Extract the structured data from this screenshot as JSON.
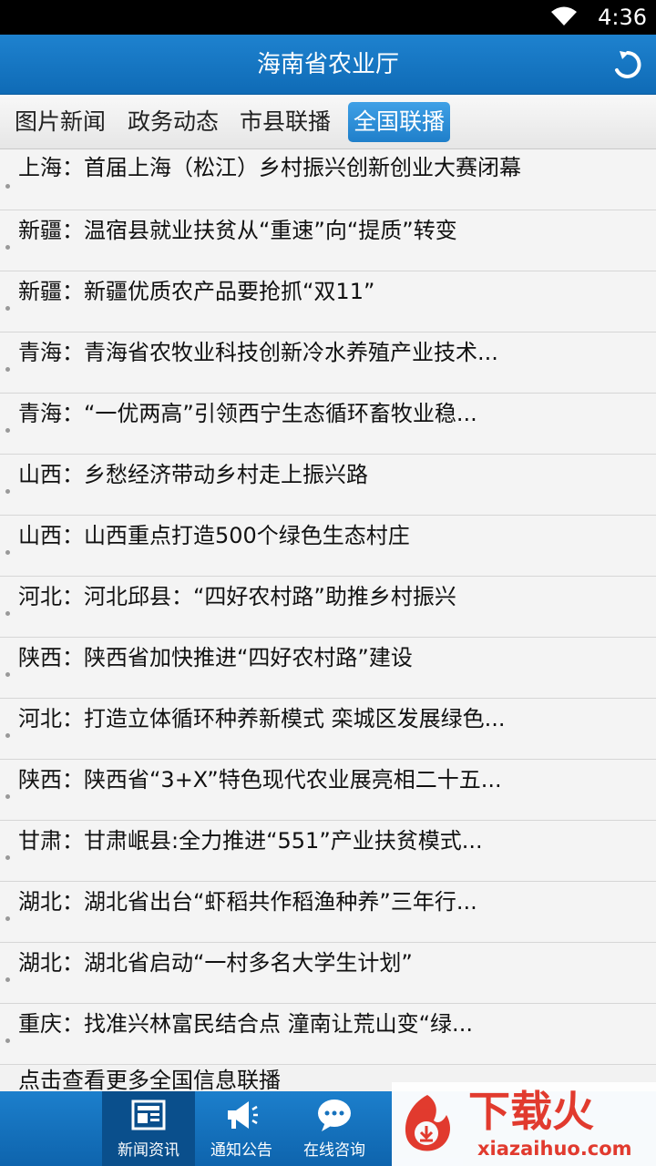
{
  "status_bar": {
    "time": "4:36",
    "wifi_icon": "wifi-icon"
  },
  "header": {
    "title": "海南省农业厅",
    "refresh_icon": "refresh-icon"
  },
  "tabs": [
    {
      "label": "图片新闻",
      "active": false
    },
    {
      "label": "政务动态",
      "active": false
    },
    {
      "label": "市县联播",
      "active": false
    },
    {
      "label": "全国联播",
      "active": true
    }
  ],
  "news": [
    "上海：首届上海（松江）乡村振兴创新创业大赛闭幕",
    "新疆：温宿县就业扶贫从“重速”向“提质”转变",
    "新疆：新疆优质农产品要抢抓“双11”",
    "青海：青海省农牧业科技创新冷水养殖产业技术...",
    "青海：“一优两高”引领西宁生态循环畜牧业稳...",
    "山西：乡愁经济带动乡村走上振兴路",
    "山西：山西重点打造500个绿色生态村庄",
    "河北：河北邱县：“四好农村路”助推乡村振兴",
    "陕西：陕西省加快推进“四好农村路”建设",
    "河北：打造立体循环种养新模式 栾城区发展绿色...",
    "陕西：陕西省“3+X”特色现代农业展亮相二十五...",
    "甘肃：甘肃岷县:全力推进“551”产业扶贫模式...",
    "湖北：湖北省出台“虾稻共作稻渔种养”三年行...",
    "湖北：湖北省启动“一村多名大学生计划”",
    "重庆：找准兴林富民结合点 潼南让荒山变“绿..."
  ],
  "more_link": "点击查看更多全国信息联播",
  "bottom_nav": [
    {
      "label": "新闻资讯",
      "icon": "newspaper-icon",
      "active": true
    },
    {
      "label": "通知公告",
      "icon": "megaphone-icon",
      "active": false
    },
    {
      "label": "在线咨询",
      "icon": "chat-bubble-icon",
      "active": false
    }
  ],
  "watermark": {
    "title": "下载火",
    "subtitle": "xiazaihuo.com"
  },
  "colors": {
    "header_blue": "#1479c4",
    "active_tab": "#2a8ad6",
    "watermark_red": "#e8392a"
  }
}
